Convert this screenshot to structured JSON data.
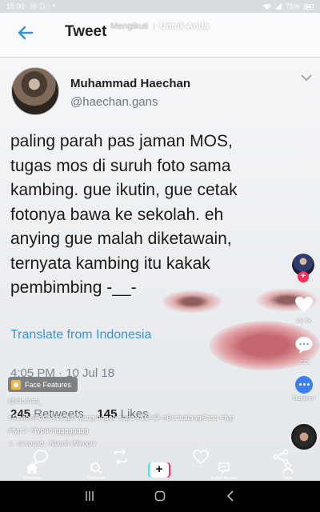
{
  "status_bar": {
    "time": "15:00",
    "battery": "75%"
  },
  "tweet": {
    "header_title": "Tweet",
    "name": "Muhammad Haechan",
    "handle": "@haechan.gans",
    "text_lines": [
      "paling parah pas jaman MOS,",
      "tugas mos di suruh foto sama",
      "kambing. gue ikutin, gue cetak",
      "fotonya bawa ke sekolah. eh",
      "anying gue malah diketawain,",
      "ternyata kambing itu kakak",
      "pembimbing -__-"
    ],
    "translate": "Translate from Indonesia",
    "date": "4:05 PM · 10 Jul 18",
    "retweets_count": "245",
    "retweets_label": "Retweets",
    "likes_count": "145",
    "likes_label": "Likes"
  },
  "tiktok": {
    "tab_following": "Mengikuti",
    "tab_separator": "|",
    "tab_for_you": "Untuk Anda",
    "likes": "29.7K",
    "comments": "733",
    "share_label": "Bagikan",
    "effect_label": "Face Features",
    "username": "@idorhas_",
    "caption_line1": "#MakeAFace kok gini yang begoe sapa ya😂😂 #BertualangRasa #fyp",
    "caption_line2": "#fypシ #fypdongggggggg",
    "sound": "al sound - Niamh (Mengar"
  },
  "bottom_nav": [
    {
      "label": "Beranda",
      "icon": "home-icon"
    },
    {
      "label": "Temukan",
      "icon": "search-icon"
    },
    {
      "label": "+",
      "icon": "add-icon"
    },
    {
      "label": "Kotak Masuk",
      "icon": "inbox-icon"
    },
    {
      "label": "Saya",
      "icon": "profile-icon"
    }
  ],
  "colors": {
    "twitter_blue": "#3b93d6",
    "tiktok_red": "#fe2c55",
    "tiktok_cyan": "#25f4ee"
  }
}
